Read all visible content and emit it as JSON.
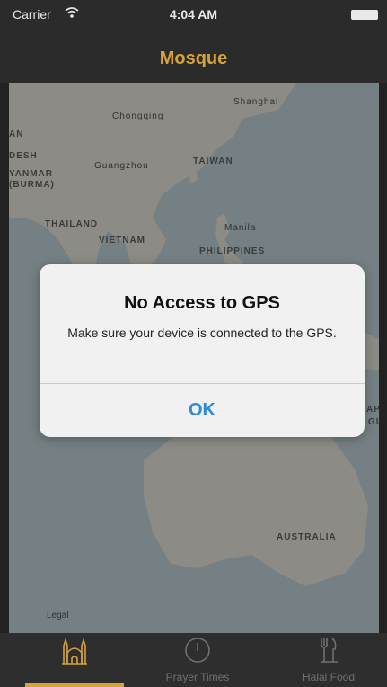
{
  "status_bar": {
    "carrier": "Carrier",
    "wifi_icon": "wifi-icon",
    "time": "4:04 AM",
    "battery_icon": "battery-icon"
  },
  "nav": {
    "title": "Mosque"
  },
  "map": {
    "labels": {
      "an": "AN",
      "desh": "DESH",
      "myanmar": "YANMAR",
      "burma": "(BURMA)",
      "chongqing": "Chongqing",
      "shanghai": "Shanghai",
      "guangzhou": "Guangzhou",
      "taiwan": "TAIWAN",
      "thailand": "THAILAND",
      "vietnam": "VIETNAM",
      "manila": "Manila",
      "philippines": "PHILIPPINES",
      "apu": "APU",
      "gu": "GU",
      "australia": "AUSTRALIA"
    },
    "legal": "Legal"
  },
  "alert": {
    "title": "No Access to GPS",
    "message": "Make sure your device is connected to the GPS.",
    "ok_label": "OK"
  },
  "tabs": [
    {
      "label": "",
      "icon": "mosque-icon",
      "active": true
    },
    {
      "label": "Prayer Times",
      "icon": "clock-icon",
      "active": false
    },
    {
      "label": "Halal Food",
      "icon": "cutlery-icon",
      "active": false
    }
  ],
  "colors": {
    "accent": "#d6a33a",
    "bar_bg": "#2b2b2b",
    "alert_button": "#2f8ad8",
    "water": "#c9dde2",
    "land": "#f2efe6"
  }
}
